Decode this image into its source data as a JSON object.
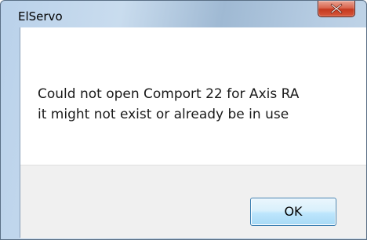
{
  "window": {
    "title": "ElServo"
  },
  "titlebar": {
    "close_icon": "close-icon",
    "close_color": "#c9452b"
  },
  "message": {
    "line1": "Could not open Comport 22 for Axis RA",
    "line2": "it might not exist or already be in use"
  },
  "buttons": {
    "ok_label": "OK"
  }
}
